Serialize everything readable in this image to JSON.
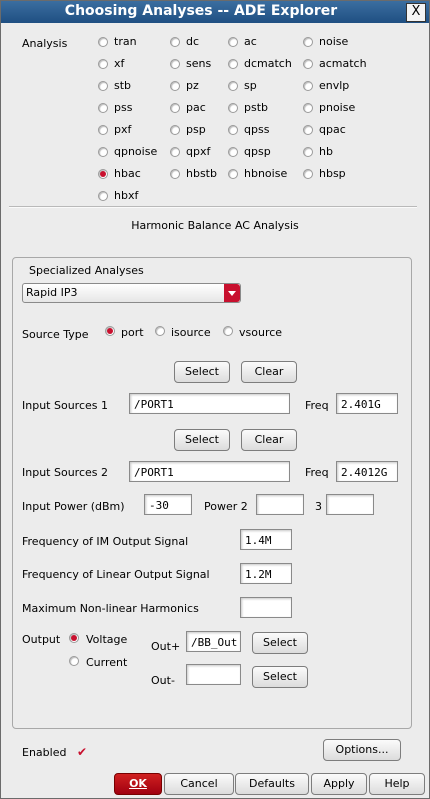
{
  "window": {
    "title": "Choosing Analyses -- ADE Explorer",
    "close_glyph": "X"
  },
  "analysis": {
    "label": "Analysis",
    "options": [
      [
        "tran",
        "dc",
        "ac",
        "noise"
      ],
      [
        "xf",
        "sens",
        "dcmatch",
        "acmatch"
      ],
      [
        "stb",
        "pz",
        "sp",
        "envlp"
      ],
      [
        "pss",
        "pac",
        "pstb",
        "pnoise"
      ],
      [
        "pxf",
        "psp",
        "qpss",
        "qpac"
      ],
      [
        "qpnoise",
        "qpxf",
        "qpsp",
        "hb"
      ],
      [
        "hbac",
        "hbstb",
        "hbnoise",
        "hbsp"
      ],
      [
        "hbxf"
      ]
    ],
    "selected": "hbac"
  },
  "section_title": "Harmonic Balance AC Analysis",
  "specialized": {
    "label": "Specialized Analyses",
    "value": "Rapid IP3"
  },
  "source_type": {
    "label": "Source Type",
    "options": [
      "port",
      "isource",
      "vsource"
    ],
    "selected": "port"
  },
  "buttons": {
    "select": "Select",
    "clear": "Clear"
  },
  "input1": {
    "label": "Input Sources 1",
    "value": "/PORT1",
    "freq_label": "Freq",
    "freq": "2.401G"
  },
  "input2": {
    "label": "Input Sources 2",
    "value": "/PORT1",
    "freq_label": "Freq",
    "freq": "2.4012G"
  },
  "power": {
    "label": "Input Power (dBm)",
    "value": "-30",
    "power2_label": "Power 2",
    "power2": "",
    "power3_label": "3",
    "power3": ""
  },
  "im_freq": {
    "label": "Frequency of IM Output Signal",
    "value": "1.4M"
  },
  "linear_freq": {
    "label": "Frequency of Linear Output Signal",
    "value": "1.2M"
  },
  "max_harm": {
    "label": "Maximum Non-linear Harmonics",
    "value": ""
  },
  "output": {
    "label": "Output",
    "options": [
      "Voltage",
      "Current"
    ],
    "selected": "Voltage",
    "outp_label": "Out+",
    "outp": "/BB_Out",
    "outm_label": "Out-",
    "outm": ""
  },
  "enabled": {
    "label": "Enabled",
    "check": "✔"
  },
  "footer": {
    "options": "Options...",
    "ok": "OK",
    "cancel": "Cancel",
    "defaults": "Defaults",
    "apply": "Apply",
    "help": "Help"
  }
}
